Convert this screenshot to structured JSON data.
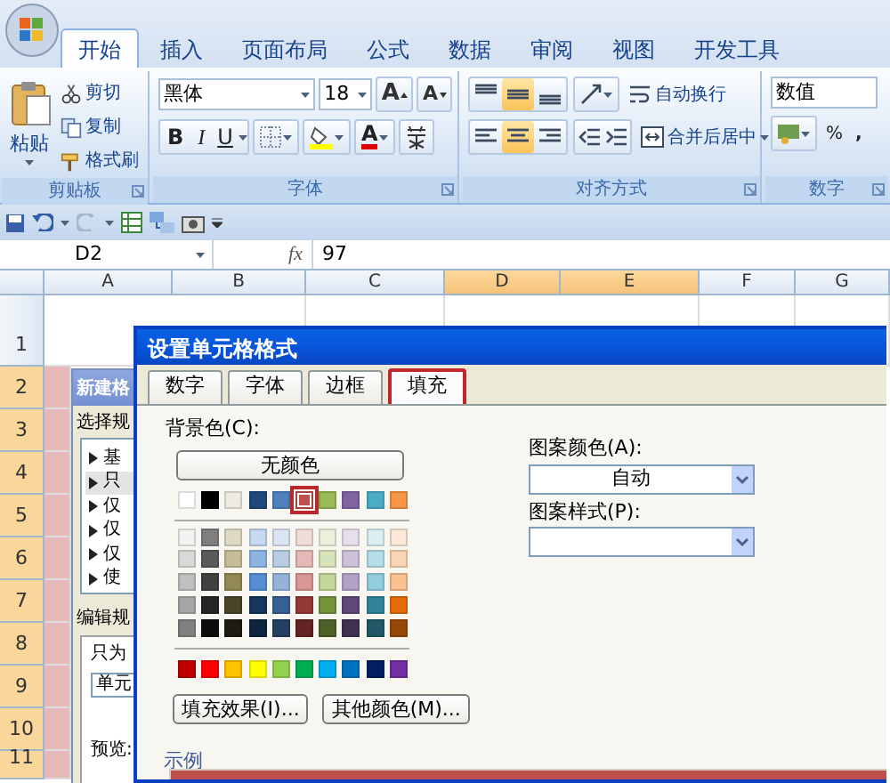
{
  "ribbon": {
    "tabs": [
      {
        "label": "开始",
        "selected": true
      },
      {
        "label": "插入",
        "selected": false
      },
      {
        "label": "页面布局",
        "selected": false
      },
      {
        "label": "公式",
        "selected": false
      },
      {
        "label": "数据",
        "selected": false
      },
      {
        "label": "审阅",
        "selected": false
      },
      {
        "label": "视图",
        "selected": false
      },
      {
        "label": "开发工具",
        "selected": false
      }
    ],
    "clipboard": {
      "label": "剪贴板",
      "paste": "粘贴",
      "items": [
        "剪切",
        "复制",
        "格式刷"
      ]
    },
    "font": {
      "label": "字体",
      "family": "黑体",
      "size": "18",
      "grow": "A",
      "shrink": "A",
      "bold": "B",
      "italic": "I",
      "underline": "U",
      "font_color": "A"
    },
    "alignment": {
      "label": "对齐方式",
      "vertical": [
        {
          "selected": false
        },
        {
          "selected": true
        },
        {
          "selected": false
        }
      ],
      "horizontal": [
        {
          "selected": false
        },
        {
          "selected": true
        },
        {
          "selected": false
        }
      ],
      "wrap": "自动换行",
      "merge": "合并后居中"
    },
    "number": {
      "label": "数字",
      "format": "数值",
      "percent": "%",
      "comma": ","
    }
  },
  "formula_bar": {
    "name_box": "D2",
    "fx": "fx",
    "value": "97"
  },
  "sheet": {
    "columns": [
      {
        "label": "A",
        "selected": false
      },
      {
        "label": "B",
        "selected": false
      },
      {
        "label": "C",
        "selected": false
      },
      {
        "label": "D",
        "selected": true
      },
      {
        "label": "E",
        "selected": true
      },
      {
        "label": "F",
        "selected": false
      },
      {
        "label": "G",
        "selected": false
      }
    ],
    "rows": [
      {
        "label": "1",
        "selected": false
      },
      {
        "label": "2",
        "selected": true
      },
      {
        "label": "3",
        "selected": true
      },
      {
        "label": "4",
        "selected": true
      },
      {
        "label": "5",
        "selected": true
      },
      {
        "label": "6",
        "selected": true
      },
      {
        "label": "7",
        "selected": true
      },
      {
        "label": "8",
        "selected": true
      },
      {
        "label": "9",
        "selected": true
      },
      {
        "label": "10",
        "selected": true
      },
      {
        "label": "11",
        "selected": true
      }
    ]
  },
  "rule_dialog": {
    "title": "新建格",
    "type_label": "选择规",
    "types": [
      {
        "text": "基",
        "selected": false
      },
      {
        "text": "只",
        "selected": true
      },
      {
        "text": "仅",
        "selected": false
      },
      {
        "text": "仅",
        "selected": false
      },
      {
        "text": "仅",
        "selected": false
      },
      {
        "text": "使",
        "selected": false
      }
    ],
    "edit_label": "编辑规",
    "description": "只为",
    "combo": "单元",
    "preview": "预览:"
  },
  "format_dialog": {
    "title": "设置单元格格式",
    "tabs": [
      {
        "label": "数字",
        "selected": false
      },
      {
        "label": "字体",
        "selected": false
      },
      {
        "label": "边框",
        "selected": false
      },
      {
        "label": "填充",
        "selected": true
      }
    ],
    "background_label": "背景色(C):",
    "no_color": "无颜色",
    "theme_colors": [
      {
        "color": "#ffffff",
        "selected": false
      },
      {
        "color": "#000000",
        "selected": false
      },
      {
        "color": "#eeece1",
        "selected": false
      },
      {
        "color": "#1f497d",
        "selected": false
      },
      {
        "color": "#4f81bd",
        "selected": false
      },
      {
        "color": "#c0504d",
        "selected": true
      },
      {
        "color": "#9bbb59",
        "selected": false
      },
      {
        "color": "#8064a2",
        "selected": false
      },
      {
        "color": "#4bacc6",
        "selected": false
      },
      {
        "color": "#f79646",
        "selected": false
      }
    ],
    "tint_rows": [
      {
        "swatches": [
          {
            "color": "#f2f2f2",
            "selected": false
          },
          {
            "color": "#7f7f7f",
            "selected": false
          },
          {
            "color": "#ddd9c3",
            "selected": false
          },
          {
            "color": "#c6d9f0",
            "selected": false
          },
          {
            "color": "#dbe5f1",
            "selected": false
          },
          {
            "color": "#f2dcdb",
            "selected": false
          },
          {
            "color": "#ebf1dd",
            "selected": false
          },
          {
            "color": "#e5e0ec",
            "selected": false
          },
          {
            "color": "#dbeef3",
            "selected": false
          },
          {
            "color": "#fdeada",
            "selected": false
          }
        ]
      },
      {
        "swatches": [
          {
            "color": "#d9d9d9",
            "selected": false
          },
          {
            "color": "#595959",
            "selected": false
          },
          {
            "color": "#c4bd97",
            "selected": false
          },
          {
            "color": "#8db3e2",
            "selected": false
          },
          {
            "color": "#b8cce4",
            "selected": false
          },
          {
            "color": "#e5b9b7",
            "selected": false
          },
          {
            "color": "#d7e3bc",
            "selected": false
          },
          {
            "color": "#ccc1d9",
            "selected": false
          },
          {
            "color": "#b7dde8",
            "selected": false
          },
          {
            "color": "#fbd5b5",
            "selected": false
          }
        ]
      },
      {
        "swatches": [
          {
            "color": "#bfbfbf",
            "selected": false
          },
          {
            "color": "#404040",
            "selected": false
          },
          {
            "color": "#938953",
            "selected": false
          },
          {
            "color": "#548dd4",
            "selected": false
          },
          {
            "color": "#95b3d7",
            "selected": false
          },
          {
            "color": "#d99694",
            "selected": false
          },
          {
            "color": "#c3d69b",
            "selected": false
          },
          {
            "color": "#b2a2c7",
            "selected": false
          },
          {
            "color": "#92cddc",
            "selected": false
          },
          {
            "color": "#fac08f",
            "selected": false
          }
        ]
      },
      {
        "swatches": [
          {
            "color": "#a6a6a6",
            "selected": false
          },
          {
            "color": "#262626",
            "selected": false
          },
          {
            "color": "#494429",
            "selected": false
          },
          {
            "color": "#17365d",
            "selected": false
          },
          {
            "color": "#366092",
            "selected": false
          },
          {
            "color": "#953734",
            "selected": false
          },
          {
            "color": "#76923c",
            "selected": false
          },
          {
            "color": "#5f497a",
            "selected": false
          },
          {
            "color": "#31859b",
            "selected": false
          },
          {
            "color": "#e36c09",
            "selected": false
          }
        ]
      },
      {
        "swatches": [
          {
            "color": "#808080",
            "selected": false
          },
          {
            "color": "#0d0d0d",
            "selected": false
          },
          {
            "color": "#1d1b10",
            "selected": false
          },
          {
            "color": "#0f243e",
            "selected": false
          },
          {
            "color": "#244061",
            "selected": false
          },
          {
            "color": "#632423",
            "selected": false
          },
          {
            "color": "#4f6128",
            "selected": false
          },
          {
            "color": "#3f3151",
            "selected": false
          },
          {
            "color": "#205867",
            "selected": false
          },
          {
            "color": "#974806",
            "selected": false
          }
        ]
      }
    ],
    "standard_colors": [
      {
        "color": "#c00000",
        "selected": false
      },
      {
        "color": "#ff0000",
        "selected": false
      },
      {
        "color": "#ffc000",
        "selected": false
      },
      {
        "color": "#ffff00",
        "selected": false
      },
      {
        "color": "#92d050",
        "selected": false
      },
      {
        "color": "#00b050",
        "selected": false
      },
      {
        "color": "#00b0f0",
        "selected": false
      },
      {
        "color": "#0070c0",
        "selected": false
      },
      {
        "color": "#002060",
        "selected": false
      },
      {
        "color": "#7030a0",
        "selected": false
      }
    ],
    "fill_effects": "填充效果(I)...",
    "more_colors": "其他颜色(M)...",
    "pattern_color_label": "图案颜色(A):",
    "pattern_color": "自动",
    "pattern_style_label": "图案样式(P):",
    "sample_label": "示例"
  }
}
